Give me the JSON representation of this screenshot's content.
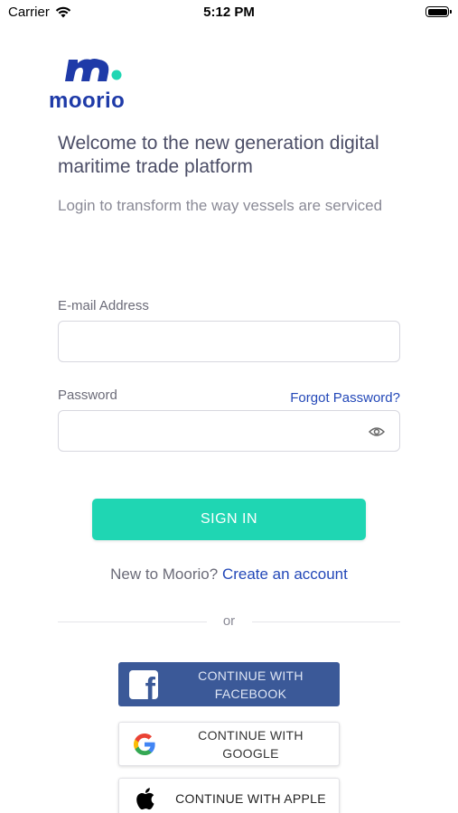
{
  "status_bar": {
    "carrier": "Carrier",
    "time": "5:12 PM"
  },
  "brand": {
    "name": "moorio",
    "primary_color": "#1e3aa8",
    "accent_color": "#1fd6b3"
  },
  "intro": {
    "headline": "Welcome to the new generation digital maritime trade platform",
    "subline": "Login to transform the way vessels are serviced"
  },
  "form": {
    "email_label": "E-mail Address",
    "email_value": "",
    "password_label": "Password",
    "password_value": "",
    "forgot_password": "Forgot Password?",
    "show_password_icon": "eye-icon",
    "sign_in": "SIGN IN"
  },
  "signup": {
    "prompt": "New to Moorio?",
    "link": "Create an account"
  },
  "divider_text": "or",
  "social": {
    "facebook": "CONTINUE WITH FACEBOOK",
    "google": "CONTINUE WITH GOOGLE",
    "apple": "CONTINUE WITH APPLE",
    "facebook_color": "#3b5998"
  }
}
